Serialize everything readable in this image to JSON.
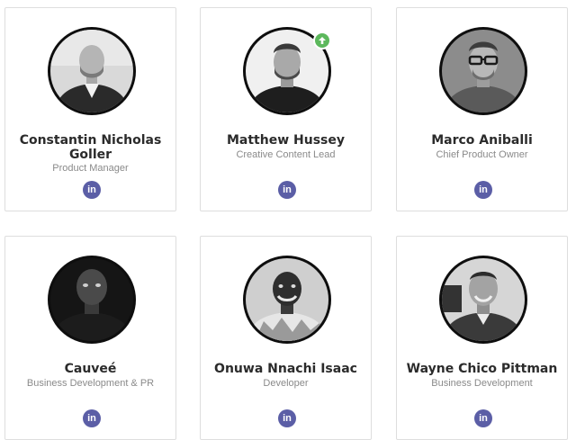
{
  "team": [
    {
      "name": "Constantin Nicholas Goller",
      "role": "Product Manager",
      "photo_icon": "person-photo",
      "social": {
        "icon": "linkedin-icon",
        "label": "in"
      }
    },
    {
      "name": "Matthew Hussey",
      "role": "Creative Content Lead",
      "photo_icon": "person-photo",
      "badge_icon": "arrow-up-icon",
      "social": {
        "icon": "linkedin-icon",
        "label": "in"
      }
    },
    {
      "name": "Marco Aniballi",
      "role": "Chief Product Owner",
      "photo_icon": "person-photo",
      "social": {
        "icon": "linkedin-icon",
        "label": "in"
      }
    },
    {
      "name": "Cauveé",
      "role": "Business Development & PR",
      "photo_icon": "person-photo",
      "social": {
        "icon": "linkedin-icon",
        "label": "in"
      }
    },
    {
      "name": "Onuwa Nnachi Isaac",
      "role": "Developer",
      "photo_icon": "person-photo",
      "social": {
        "icon": "linkedin-icon",
        "label": "in"
      }
    },
    {
      "name": "Wayne Chico Pittman",
      "role": "Business Development",
      "photo_icon": "person-photo",
      "social": {
        "icon": "linkedin-icon",
        "label": "in"
      }
    }
  ],
  "colors": {
    "linkedin_badge": "#5b5ea6",
    "upload_badge": "#5cb85c",
    "card_border": "#dedede",
    "name_text": "#2b2b2b",
    "role_text": "#8a8a8a"
  }
}
